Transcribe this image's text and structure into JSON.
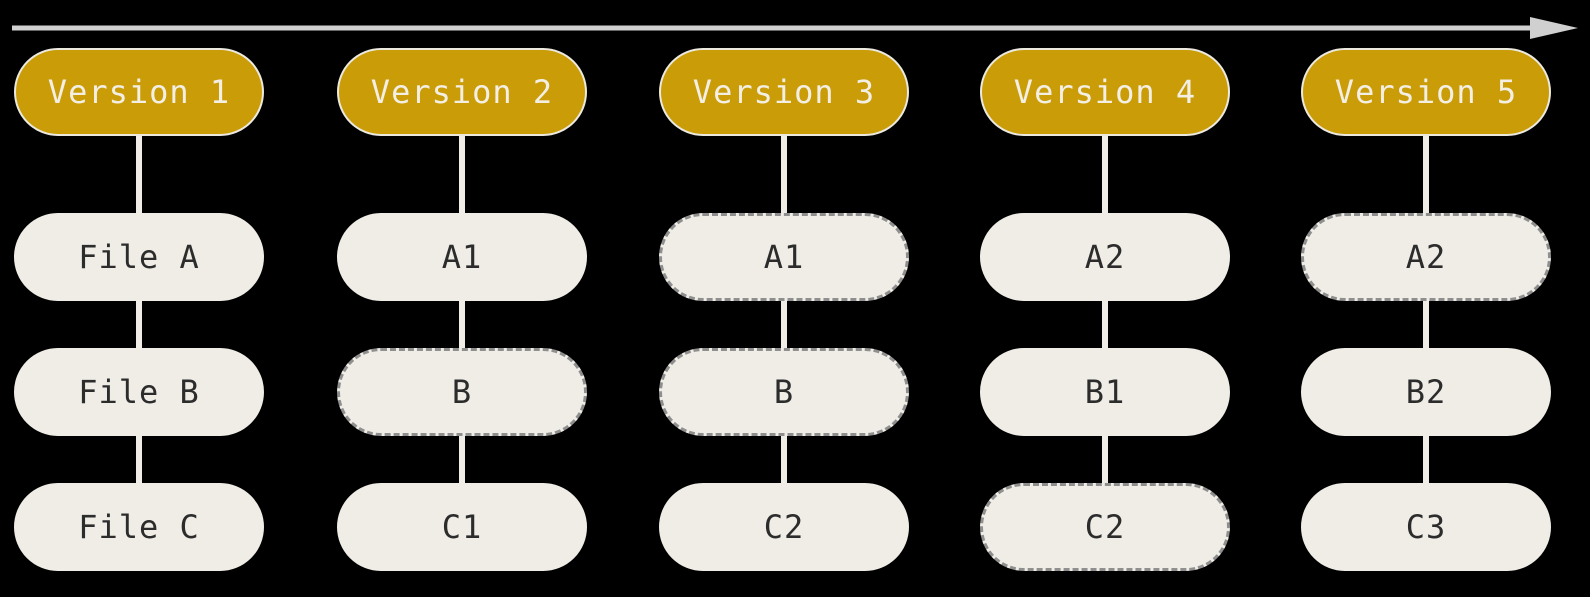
{
  "versions": [
    {
      "label": "Version 1",
      "files": [
        {
          "label": "File A",
          "unchanged": false
        },
        {
          "label": "File B",
          "unchanged": false
        },
        {
          "label": "File C",
          "unchanged": false
        }
      ]
    },
    {
      "label": "Version 2",
      "files": [
        {
          "label": "A1",
          "unchanged": false
        },
        {
          "label": "B",
          "unchanged": true
        },
        {
          "label": "C1",
          "unchanged": false
        }
      ]
    },
    {
      "label": "Version 3",
      "files": [
        {
          "label": "A1",
          "unchanged": true
        },
        {
          "label": "B",
          "unchanged": true
        },
        {
          "label": "C2",
          "unchanged": false
        }
      ]
    },
    {
      "label": "Version 4",
      "files": [
        {
          "label": "A2",
          "unchanged": false
        },
        {
          "label": "B1",
          "unchanged": false
        },
        {
          "label": "C2",
          "unchanged": true
        }
      ]
    },
    {
      "label": "Version 5",
      "files": [
        {
          "label": "A2",
          "unchanged": true
        },
        {
          "label": "B2",
          "unchanged": false
        },
        {
          "label": "C3",
          "unchanged": false
        }
      ]
    }
  ],
  "colors": {
    "background": "#000000",
    "version_fill": "#c99c08",
    "file_fill": "#efede6",
    "dashed_border": "#8f8f8f",
    "arrow": "#d0d0d0"
  },
  "icons": {
    "timeline": "right-arrow-icon"
  }
}
